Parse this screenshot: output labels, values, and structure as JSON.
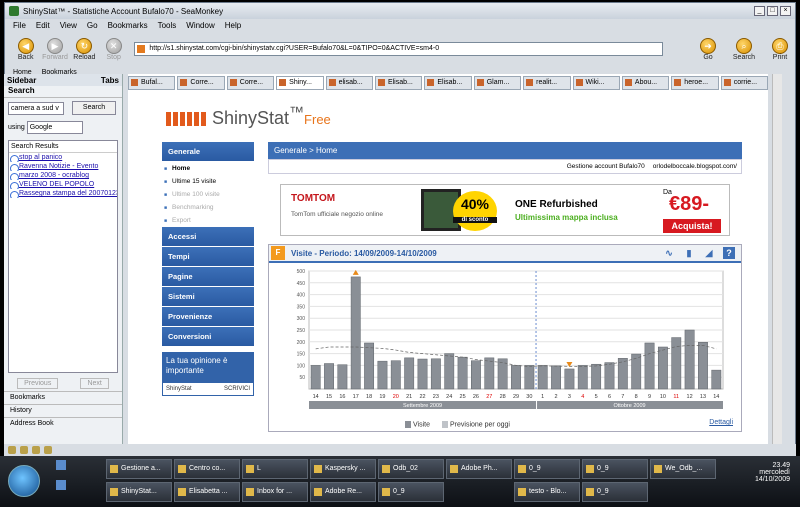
{
  "window": {
    "title": "ShinyStat™ - Statistiche Account Bufalo70 - SeaMonkey",
    "controls": [
      "_",
      "□",
      "×"
    ]
  },
  "menu": [
    "File",
    "Edit",
    "View",
    "Go",
    "Bookmarks",
    "Tools",
    "Window",
    "Help"
  ],
  "nav": {
    "back": "Back",
    "forward": "Forward",
    "reload": "Reload",
    "stop": "Stop",
    "url": "http://s1.shinystat.com/cgi-bin/shinystatv.cgi?USER=Bufalo70&L=0&TIPO=0&ACTIVE=sm4-0",
    "go": "Go",
    "search": "Search",
    "print": "Print"
  },
  "bookmarks_bar": [
    "Home",
    "Bookmarks"
  ],
  "tabs": [
    "Bufal...",
    "Corre...",
    "Corre...",
    "Shiny...",
    "elisab...",
    "Elisab...",
    "Elisab...",
    "Glam...",
    "realit...",
    "Wiki...",
    "Abou...",
    "heroe...",
    "corrie..."
  ],
  "sidebar": {
    "title": "Sidebar",
    "tabs_label": "Tabs",
    "section": "Search",
    "query": "camera a sud v",
    "search_button": "Search",
    "using_label": "using",
    "engine": "Google",
    "results_header": "Search Results",
    "results": [
      "stop al panico",
      "Ravenna Notizie - Evento",
      "marzo 2008 - ocrablog",
      "VELENO DEL POPOLO",
      "Rassegna stampa del 20070123"
    ],
    "previous": "Previous",
    "next": "Next",
    "panels": [
      "Bookmarks",
      "History",
      "Address Book"
    ]
  },
  "page": {
    "logo_text": "ShinyStat",
    "logo_tm": "™",
    "logo_free": "Free",
    "nav_general": "Generale",
    "nav_sub": [
      "Home",
      "Ultime 15 visite",
      "Ultime 100 visite",
      "Benchmarking",
      "Export"
    ],
    "nav_sections": [
      "Accessi",
      "Tempi",
      "Pagine",
      "Sistemi",
      "Provenienze",
      "Conversioni"
    ],
    "opinion": "La tua opinione è importante",
    "opinion_foot_brand": "ShinyStat",
    "opinion_foot_link": "SCRIVICI",
    "breadcrumb": "Generale > Home",
    "account_label": "Gestione account Bufalo70",
    "account_site": "orlodelboccale.blogspot.com/",
    "banner": {
      "brand": "TOMTOM",
      "sub": "TomTom ufficiale negozio online",
      "pct": "40%",
      "pct_sub": "di sconto",
      "headline": "ONE Refurbished",
      "tagline": "Ultimissima mappa inclusa",
      "da": "Da",
      "price": "€89-",
      "cta": "Acquista!"
    },
    "chart_title": "Visite - Periodo: 14/09/2009-14/10/2009",
    "legend_visits": "Visite",
    "legend_forecast": "Previsione per oggi",
    "details": "Dettagli",
    "month1": "Settembre 2009",
    "month2": "Ottobre 2009"
  },
  "chart_data": {
    "type": "bar",
    "title": "Visite - Periodo: 14/09/2009-14/10/2009",
    "ylim": [
      0,
      500
    ],
    "yticks": [
      50,
      100,
      150,
      200,
      250,
      300,
      350,
      400,
      450,
      500
    ],
    "categories": [
      "14",
      "15",
      "16",
      "17",
      "18",
      "19",
      "20",
      "21",
      "22",
      "23",
      "24",
      "25",
      "26",
      "27",
      "28",
      "29",
      "30",
      "1",
      "2",
      "3",
      "4",
      "5",
      "6",
      "7",
      "8",
      "9",
      "10",
      "11",
      "12",
      "13",
      "14"
    ],
    "red_days": [
      "20",
      "27",
      "4",
      "11"
    ],
    "series": [
      {
        "name": "Visite",
        "values": [
          100,
          108,
          103,
          475,
          195,
          118,
          120,
          132,
          127,
          128,
          150,
          135,
          120,
          132,
          128,
          100,
          100,
          100,
          98,
          85,
          100,
          105,
          112,
          130,
          148,
          195,
          178,
          218,
          250,
          198,
          80
        ]
      }
    ],
    "trend": [
      170,
      178,
      178,
      178,
      175,
      172,
      165,
      155,
      150,
      145,
      140,
      135,
      125,
      118,
      112,
      100,
      95,
      98,
      97,
      96,
      95,
      98,
      105,
      115,
      130,
      150,
      165,
      180,
      185,
      185,
      170
    ],
    "max_marker_index": 3,
    "min_marker_index": 19,
    "split_index": 17,
    "grid": true
  },
  "taskbar": {
    "row1": [
      "Gestione a...",
      "Centro co...",
      "L",
      "Kaspersky ...",
      "Odb_02",
      "Adobe Ph...",
      "0_9",
      "0_9",
      "We_Odb_..."
    ],
    "row2": [
      "ShinyStat...",
      "Elisabetta ...",
      "Inbox for ...",
      "Adobe Re...",
      "0_9",
      "",
      "testo - Blo...",
      "0_9",
      ""
    ],
    "time": "23.49",
    "day": "mercoledì",
    "date": "14/10/2009"
  }
}
